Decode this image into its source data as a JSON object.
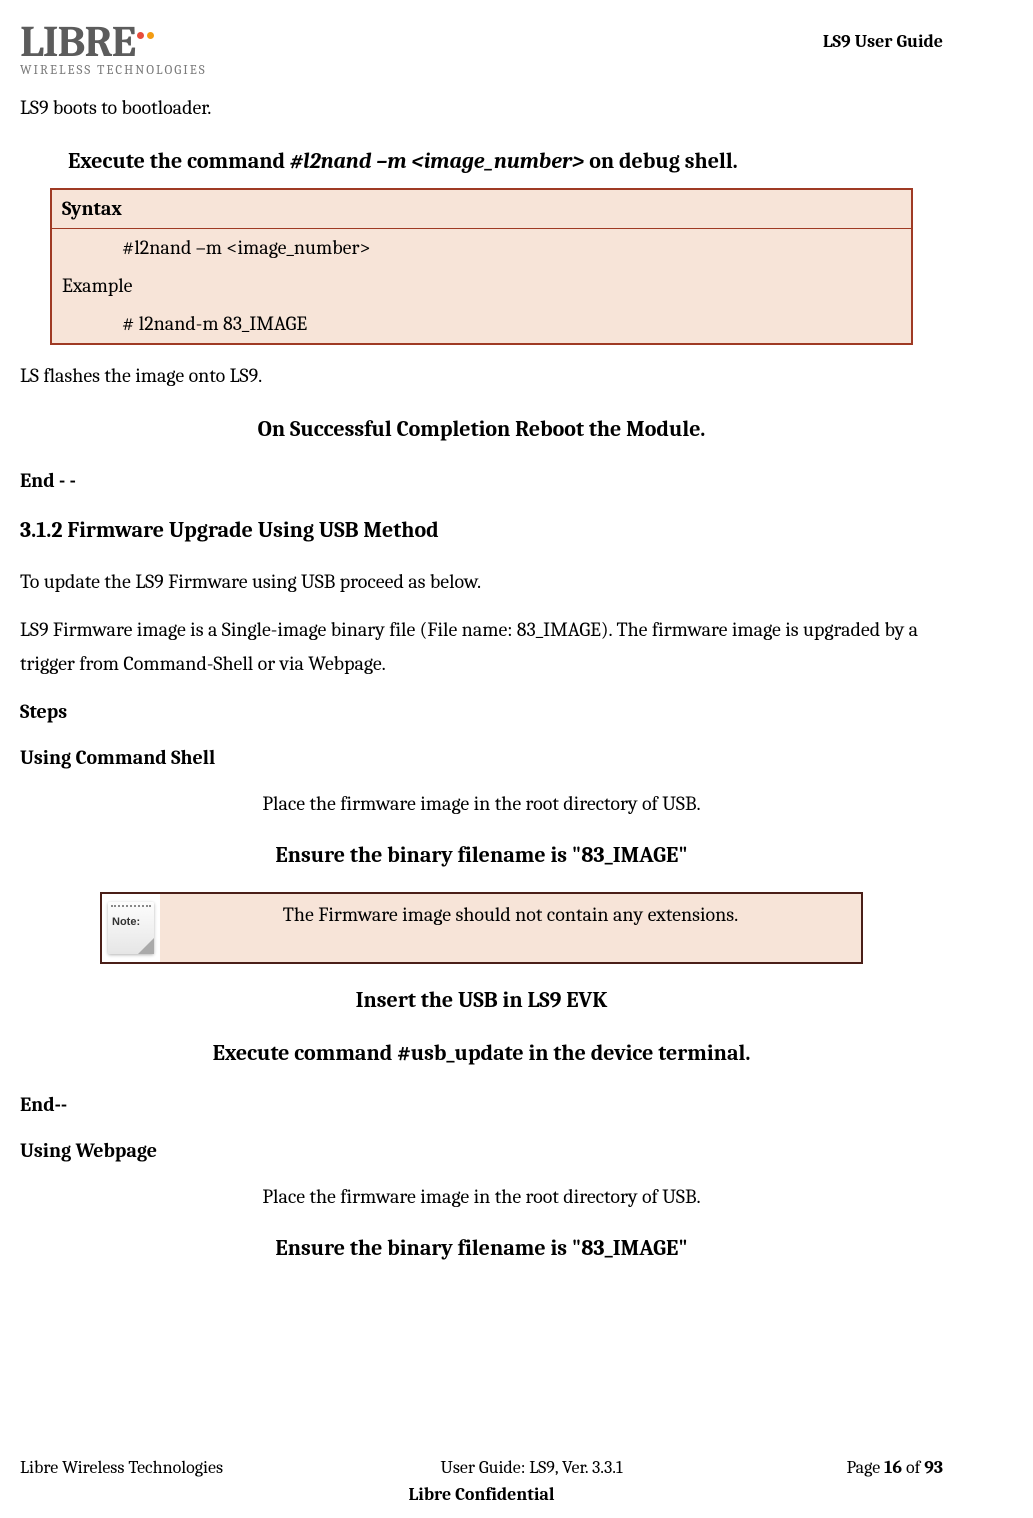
{
  "header": {
    "logo_name": "LIBRE",
    "logo_sub": "WIRELESS TECHNOLOGIES",
    "title": "LS9 User Guide"
  },
  "content": {
    "intro_line": "LS9 boots to bootloader.",
    "cmd_instruction_prefix": "Execute the command ",
    "cmd_instruction_cmd": "#l2nand –m <image_number>",
    "cmd_instruction_suffix": " on debug shell.",
    "syntax_box": {
      "header": "Syntax",
      "line1": "#l2nand –m <image_number>",
      "example_label": "Example",
      "line2": "# l2nand-m 83_IMAGE"
    },
    "ls_flash": "LS flashes the image onto LS9.",
    "reboot_msg": "On Successful Completion Reboot the Module.",
    "end1": "End - -",
    "section_num": "3.1.2 Firmware Upgrade Using USB Method",
    "usb_intro": "To update the LS9 Firmware using USB proceed as below.",
    "fw_desc": "LS9 Firmware image is a Single-image binary file (File name: 83_IMAGE). The firmware image is upgraded by a trigger from Command-Shell or via Webpage.",
    "steps_label": "Steps",
    "cmd_shell_label": "Using Command Shell",
    "place_fw": "Place the firmware image in the root directory of USB.",
    "ensure_name": "Ensure the binary filename is \"83_IMAGE\"",
    "note_icon_label": "Note:",
    "note_text": "The Firmware image should not contain any extensions.",
    "insert_usb": "Insert the USB in LS9 EVK",
    "exec_cmd": "Execute command #usb_update in the device terminal.",
    "end2": "End--",
    "webpage_label": "Using Webpage",
    "place_fw2": "Place the firmware image in the root directory of USB.",
    "ensure_name2": "Ensure the binary filename is \"83_IMAGE\""
  },
  "footer": {
    "company": "Libre Wireless Technologies",
    "guide": "User Guide: LS9, Ver. 3.3.1",
    "page_prefix": "Page ",
    "page_num": "16",
    "page_of": " of ",
    "page_total": "93",
    "confidential": "Libre Confidential"
  }
}
